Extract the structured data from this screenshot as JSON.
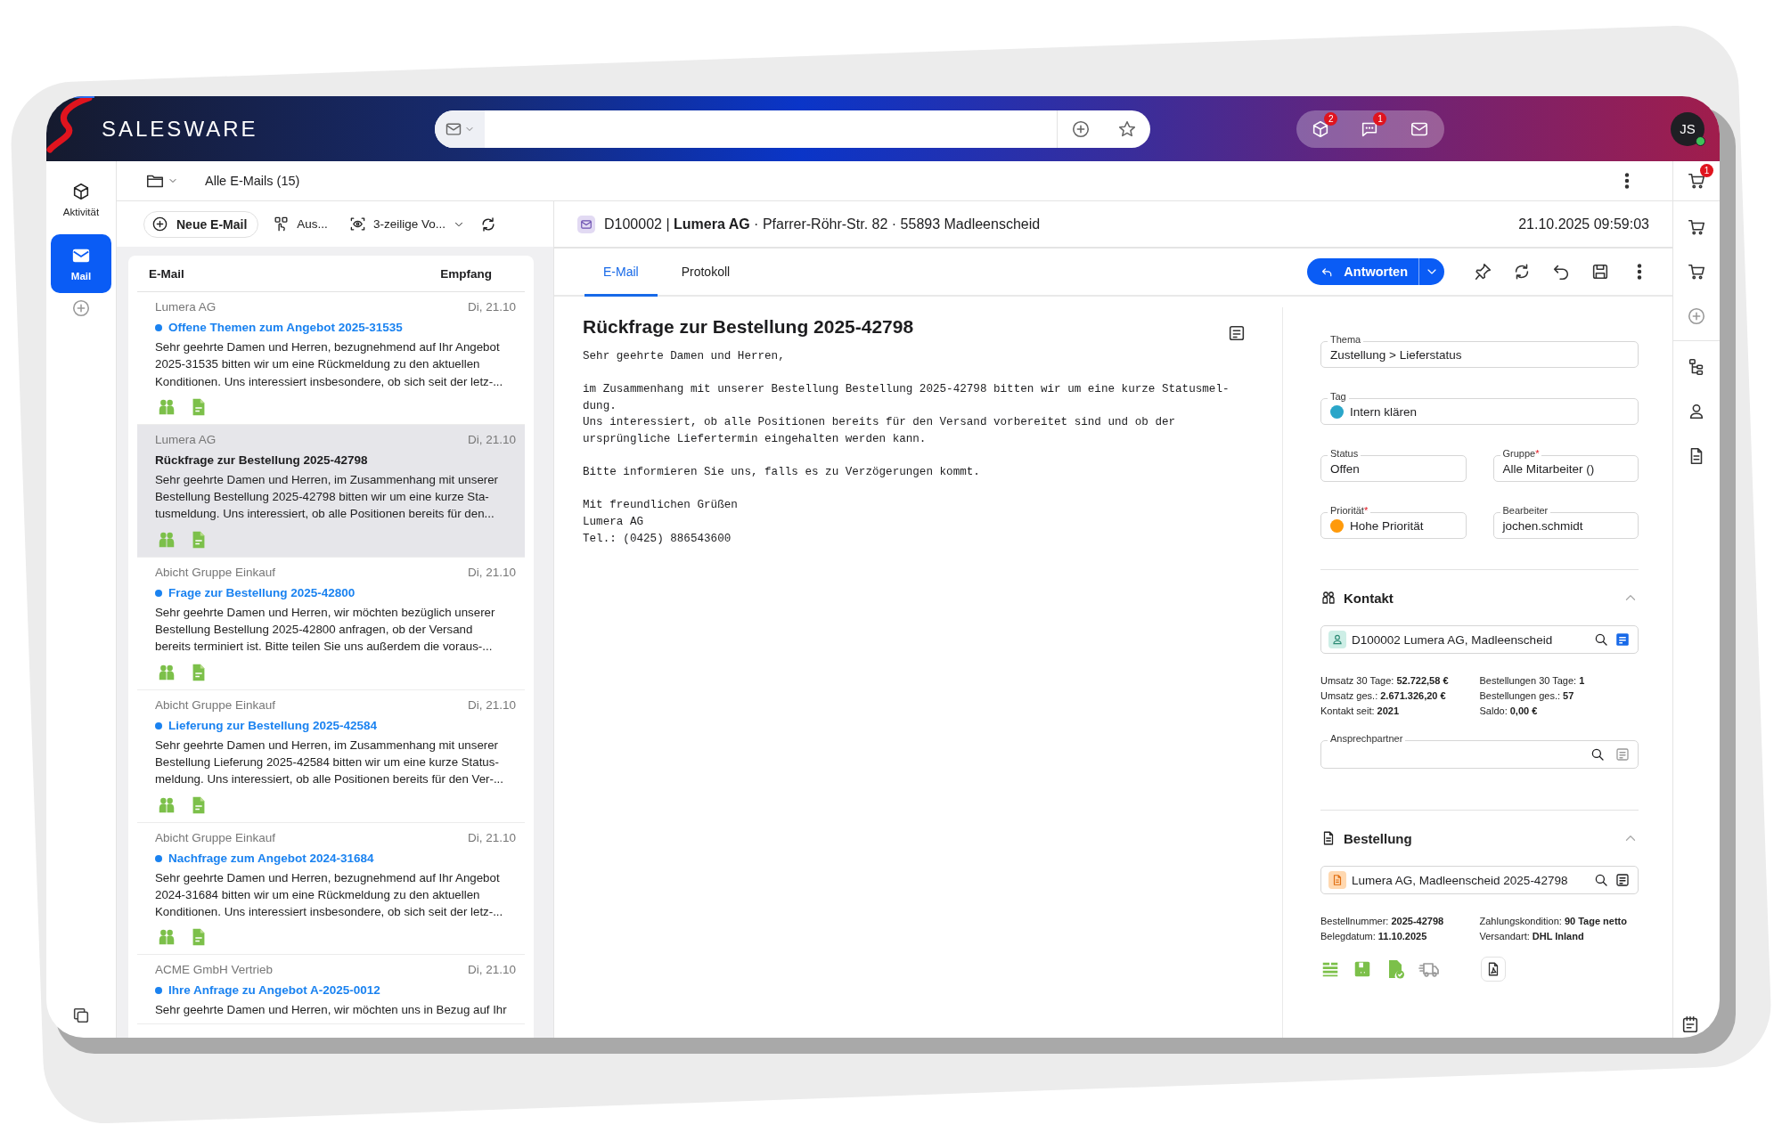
{
  "topbar": {
    "logo": "SALESWARE",
    "icons": [
      {
        "kind": "box",
        "badge": "2"
      },
      {
        "kind": "chat",
        "badge": "1"
      },
      {
        "kind": "mail"
      }
    ],
    "avatar": "JS",
    "online": true
  },
  "left_rail": [
    {
      "kind": "activity",
      "label": "Aktivität",
      "selected": false
    },
    {
      "kind": "mail",
      "label": "Mail",
      "selected": true
    }
  ],
  "folder": {
    "title": "Alle E-Mails (15)"
  },
  "list_toolbar": {
    "new_button": "Neue E-Mail",
    "select_button": "Aus...",
    "view_dropdown": "3-zeilige Vo..."
  },
  "list": {
    "columns": [
      "E-Mail",
      "Empfang"
    ],
    "items": [
      {
        "sender": "Lumera AG",
        "date": "Di, 21.10",
        "subject": "Offene Themen zum Angebot 2025-31535",
        "unread": true,
        "selected": false,
        "show_icons": true,
        "preview_lines": [
          "Sehr geehrte Damen und Herren, bezugnehmend auf Ihr Angebot",
          "2025-31535 bitten wir um eine Rückmeldung zu den aktuellen",
          "Konditionen. Uns interessiert insbesondere, ob sich seit der letz-..."
        ]
      },
      {
        "sender": "Lumera AG",
        "date": "Di, 21.10",
        "subject": "Rückfrage zur Bestellung 2025-42798",
        "unread": false,
        "selected": true,
        "show_icons": true,
        "preview_lines": [
          "Sehr geehrte Damen und Herren, im Zusammenhang mit unserer",
          "Bestellung Bestellung 2025-42798 bitten wir um eine kurze Sta-",
          "tusmeldung. Uns interessiert, ob alle Positionen bereits für den..."
        ]
      },
      {
        "sender": "Abicht Gruppe Einkauf",
        "date": "Di, 21.10",
        "subject": "Frage zur Bestellung 2025-42800",
        "unread": true,
        "selected": false,
        "show_icons": true,
        "preview_lines": [
          "Sehr geehrte Damen und Herren, wir möchten bezüglich unserer",
          "Bestellung Bestellung 2025-42800 anfragen, ob der Versand",
          "bereits terminiert ist. Bitte teilen Sie uns außerdem die voraus-..."
        ]
      },
      {
        "sender": "Abicht Gruppe Einkauf",
        "date": "Di, 21.10",
        "subject": "Lieferung zur Bestellung 2025-42584",
        "unread": true,
        "selected": false,
        "show_icons": true,
        "preview_lines": [
          "Sehr geehrte Damen und Herren, im Zusammenhang mit unserer",
          "Bestellung Lieferung 2025-42584 bitten wir um eine kurze Status-",
          "meldung. Uns interessiert, ob alle Positionen bereits für den Ver-..."
        ]
      },
      {
        "sender": "Abicht Gruppe Einkauf",
        "date": "Di, 21.10",
        "subject": "Nachfrage zum Angebot 2024-31684",
        "unread": true,
        "selected": false,
        "show_icons": true,
        "preview_lines": [
          "Sehr geehrte Damen und Herren, bezugnehmend auf Ihr Angebot",
          "2024-31684 bitten wir um eine Rückmeldung zu den aktuellen",
          "Konditionen. Uns interessiert insbesondere, ob sich seit der letz-..."
        ]
      },
      {
        "sender": "ACME GmbH Vertrieb",
        "date": "Di, 21.10",
        "subject": "Ihre Anfrage zu Angebot A-2025-0012",
        "unread": true,
        "selected": false,
        "show_icons": false,
        "preview_lines": [
          "Sehr geehrte Damen und Herren, wir möchten uns in Bezug auf Ihr"
        ]
      }
    ]
  },
  "detail": {
    "header": "D100002 | **Lumera AG** · Pfarrer-Röhr-Str. 82 · 55893 Madleenscheid",
    "date": "21.10.2025 09:59:03",
    "tabs": [
      {
        "label": "E-Mail",
        "selected": true
      },
      {
        "label": "Protokoll",
        "selected": false
      }
    ],
    "reply_button": "Antworten",
    "email": {
      "subject": "Rückfrage zur Bestellung 2025-42798",
      "paragraphs": [
        [
          "Sehr geehrte Damen und Herren,"
        ],
        [
          "im Zusammenhang mit unserer Bestellung Bestellung 2025-42798 bitten wir um eine kurze Statusmel-",
          "dung.",
          "Uns interessiert, ob alle Positionen bereits für den Versand vorbereitet sind und ob der",
          "ursprüngliche Liefertermin eingehalten werden kann."
        ],
        [
          "Bitte informieren Sie uns, falls es zu Verzögerungen kommt."
        ],
        [
          "Mit freundlichen Grüßen",
          "Lumera AG",
          "Tel.: (0425) 886543600"
        ]
      ]
    },
    "field_rows": [
      [
        {
          "label": "Thema",
          "value": "Zustellung > Lieferstatus"
        }
      ],
      [
        {
          "label": "Tag",
          "value": "Intern klären",
          "color": "#2aa6c9"
        }
      ],
      [
        {
          "label": "Status",
          "value": "Offen"
        },
        {
          "label": "Gruppe",
          "required_mark": "*",
          "value": "Alle Mitarbeiter ()"
        }
      ],
      [
        {
          "label": "Priorität",
          "required_mark": "*",
          "value": "Hohe Priorität",
          "color": "#ff9a0a"
        },
        {
          "label": "Bearbeiter",
          "value": "jochen.schmidt"
        }
      ]
    ],
    "sections": [
      {
        "kind": "contact",
        "title": "Kontakt",
        "expanded": true,
        "lookup": "D100002 Lumera AG, Madleenscheid",
        "stats": [
          [
            "Umsatz 30 Tage: **52.722,58 €**",
            "Umsatz ges.: **2.671.326,20 €**",
            "Kontakt seit: **2021**"
          ],
          [
            "Bestellungen 30 Tage: **1**",
            "Bestellungen ges.: **57**",
            "Saldo: **0,00 €**"
          ]
        ],
        "extra_field": {
          "label": "Ansprechpartner"
        }
      },
      {
        "kind": "order",
        "title": "Bestellung",
        "expanded": true,
        "lookup": "Lumera AG, Madleenscheid 2025-42798",
        "stats": [
          [
            "Bestellnummer: **2025-42798**",
            "Belegdatum: **11.10.2025**"
          ],
          [
            "Zahlungskondition: **90 Tage netto**",
            "Versandart: **DHL Inland**"
          ]
        ]
      }
    ]
  },
  "right_rail": {
    "badge": "1"
  }
}
